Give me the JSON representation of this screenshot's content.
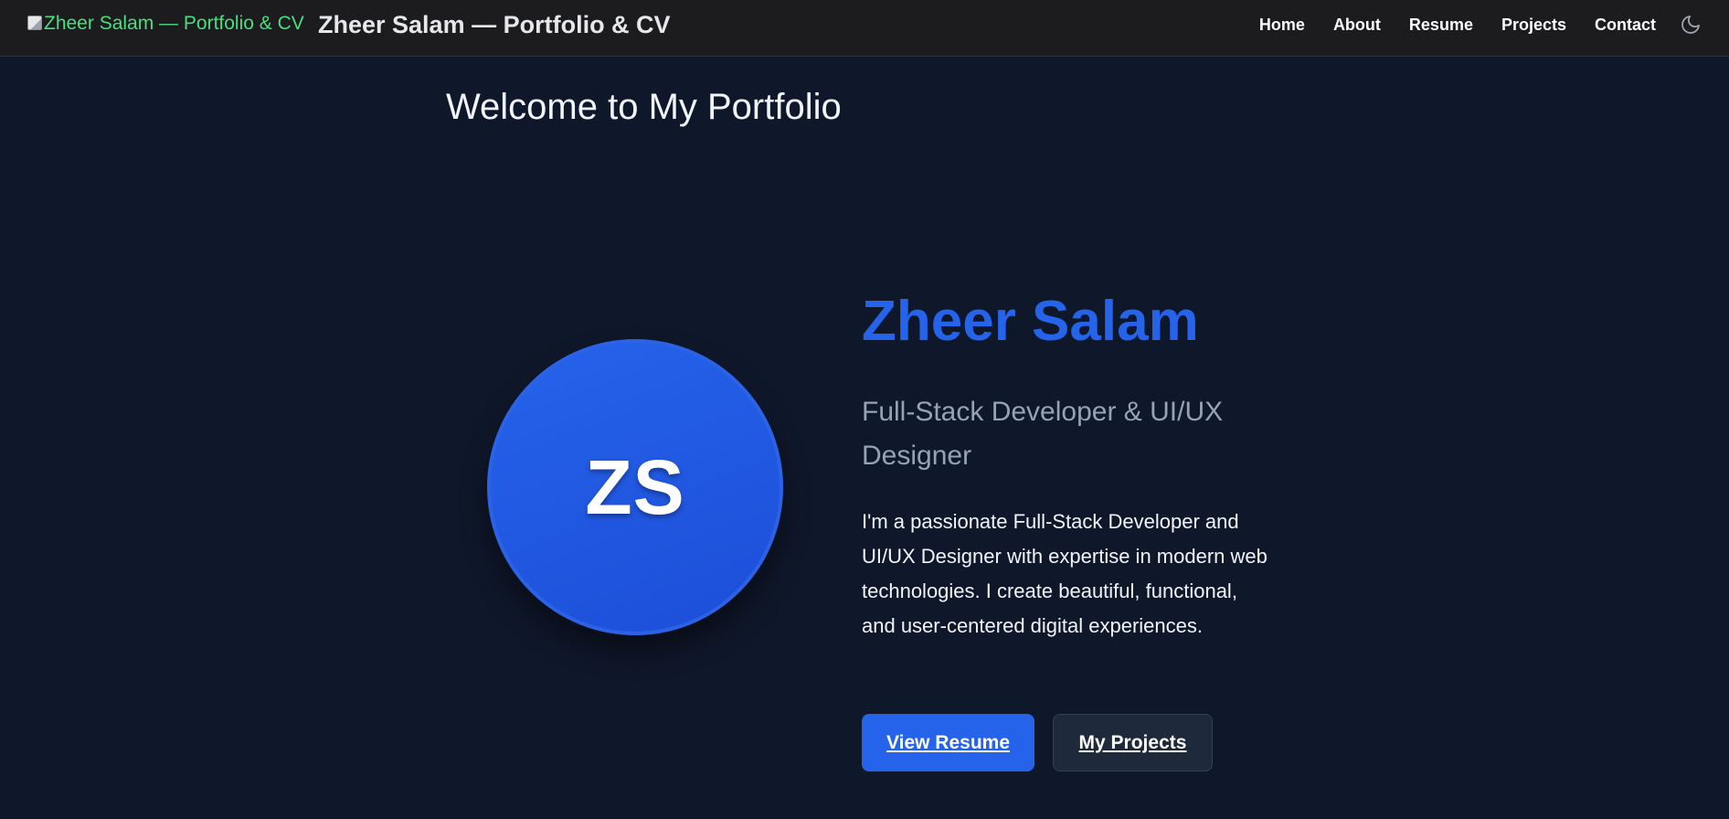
{
  "header": {
    "logo_alt": "Zheer Salam — Portfolio & CV",
    "title": "Zheer Salam — Portfolio & CV",
    "nav": [
      {
        "label": "Home"
      },
      {
        "label": "About"
      },
      {
        "label": "Resume"
      },
      {
        "label": "Projects"
      },
      {
        "label": "Contact"
      }
    ],
    "theme_icon": "moon-icon"
  },
  "main": {
    "heading": "Welcome to My Portfolio",
    "hero": {
      "avatar_initials": "ZS",
      "name": "Zheer Salam",
      "subtitle": "Full-Stack Developer & UI/UX Designer",
      "bio": "I'm a passionate Full-Stack Developer and UI/UX Designer with expertise in modern web technologies. I create beautiful, functional, and user-centered digital experiences.",
      "primary_button": "View Resume",
      "secondary_button": "My Projects"
    }
  },
  "colors": {
    "background": "#0f172a",
    "header_bg": "#1c1c1e",
    "accent": "#2563eb",
    "alt_text_green": "#4ade80",
    "muted": "#94a3b8"
  }
}
